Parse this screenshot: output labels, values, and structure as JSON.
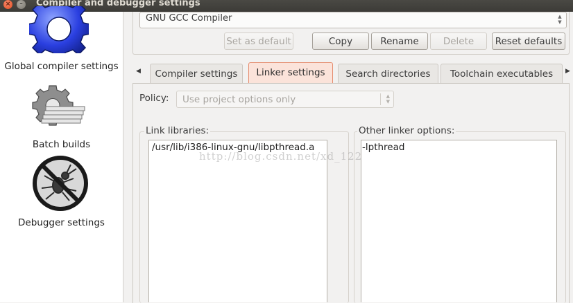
{
  "window": {
    "title": "Compiler and debugger settings",
    "close_icon": "close-icon",
    "minimize_icon": "minimize-icon"
  },
  "sidebar": {
    "items": [
      {
        "label": "Global compiler settings",
        "icon": "gear-icon"
      },
      {
        "label": "Batch builds",
        "icon": "batch-gear-icon"
      },
      {
        "label": "Debugger settings",
        "icon": "no-bug-icon"
      }
    ]
  },
  "compiler": {
    "selected": "GNU GCC Compiler",
    "buttons": {
      "set_default": "Set as default",
      "copy": "Copy",
      "rename": "Rename",
      "delete": "Delete",
      "reset": "Reset defaults"
    }
  },
  "tabs": [
    "Compiler settings",
    "Linker settings",
    "Search directories",
    "Toolchain executables"
  ],
  "active_tab": "Linker settings",
  "policy": {
    "label": "Policy:",
    "value": "Use project options only"
  },
  "link_libraries": {
    "title": "Link libraries:",
    "items": [
      "/usr/lib/i386-linux-gnu/libpthread.a"
    ]
  },
  "other_options": {
    "title": "Other linker options:",
    "value": "-lpthread"
  },
  "watermark": "http://blog.csdn.net/xd_122",
  "colors": {
    "active_tab_bg": "#fbe3da",
    "active_tab_border": "#e58c6e",
    "titlebar": "#3c3b37"
  }
}
